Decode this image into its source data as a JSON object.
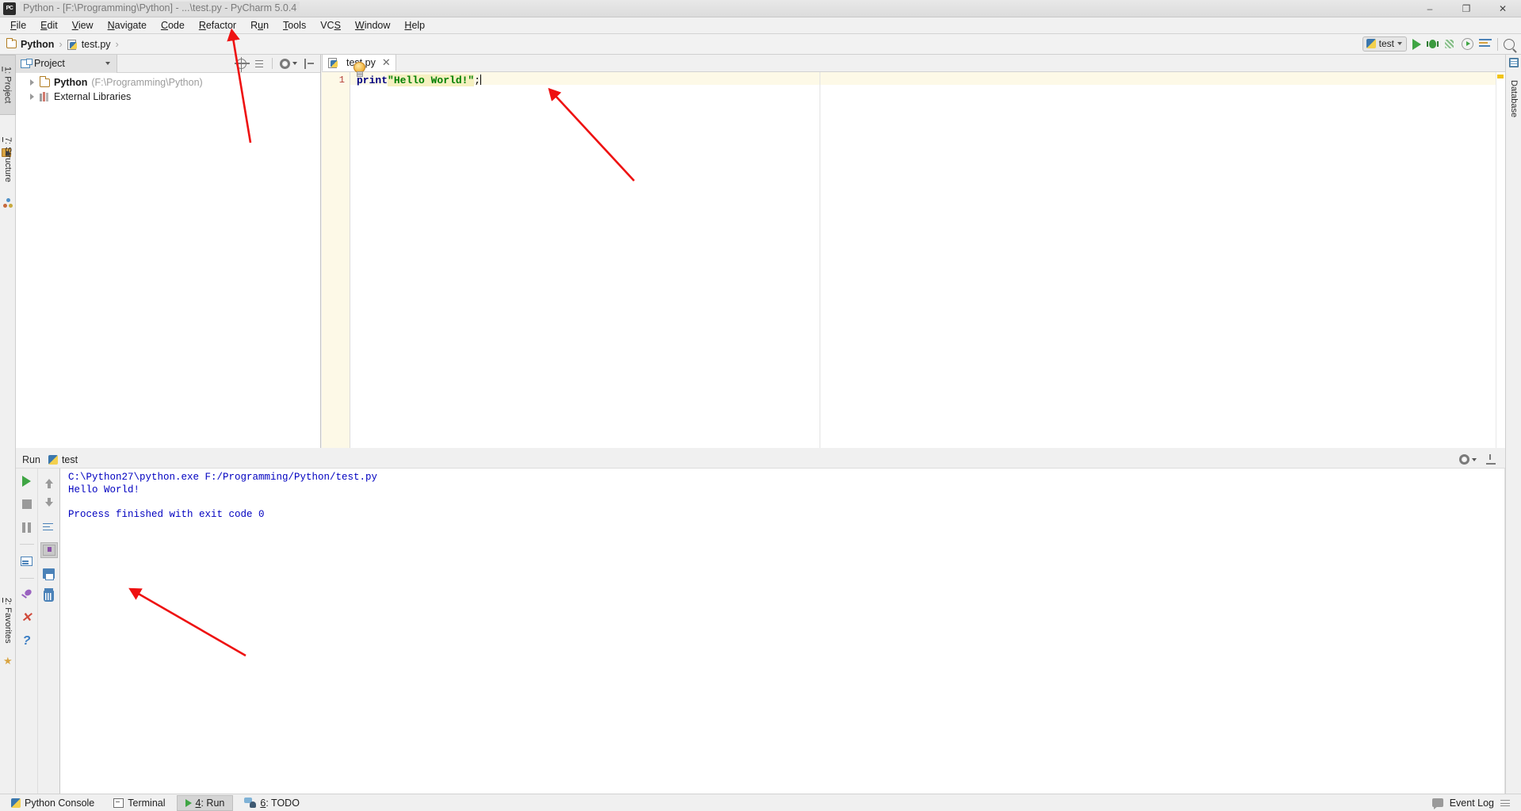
{
  "window": {
    "title": "Python - [F:\\Programming\\Python] - ...\\test.py - PyCharm 5.0.4",
    "app_icon": "PC",
    "minimize": "–",
    "maximize": "❐",
    "close": "✕"
  },
  "menu": [
    {
      "label": "File",
      "mnemonic": "F"
    },
    {
      "label": "Edit",
      "mnemonic": "E"
    },
    {
      "label": "View",
      "mnemonic": "V"
    },
    {
      "label": "Navigate",
      "mnemonic": "N"
    },
    {
      "label": "Code",
      "mnemonic": "C"
    },
    {
      "label": "Refactor",
      "mnemonic": "R"
    },
    {
      "label": "Run",
      "mnemonic": "u"
    },
    {
      "label": "Tools",
      "mnemonic": "T"
    },
    {
      "label": "VCS",
      "mnemonic": "S"
    },
    {
      "label": "Window",
      "mnemonic": "W"
    },
    {
      "label": "Help",
      "mnemonic": "H"
    }
  ],
  "breadcrumb": {
    "project": "Python",
    "file": "test.py",
    "separator": "›"
  },
  "nav_right": {
    "run_config": "test",
    "icons": [
      "run-icon",
      "debug-icon",
      "coverage-icon",
      "profile-icon",
      "attach-icon",
      "search-everywhere-icon"
    ]
  },
  "left_strip": [
    {
      "label": "1: Project",
      "mnemonic": "1",
      "icon": "project-icon",
      "active": true
    },
    {
      "label": "7: Structure",
      "mnemonic": "7",
      "icon": "structure-icon",
      "active": false
    },
    {
      "label": "2: Favorites",
      "mnemonic": "2",
      "icon": "star-icon",
      "active": false
    }
  ],
  "right_strip": [
    {
      "label": "Database",
      "icon": "database-icon",
      "active": false
    }
  ],
  "project_panel": {
    "tab_label": "Project",
    "toolbar_icons": [
      "target-icon",
      "collapse-all-icon",
      "gear-icon",
      "hide-icon"
    ],
    "tree": [
      {
        "label": "Python",
        "path": "(F:\\Programming\\Python)",
        "icon": "folder-icon",
        "expandable": true,
        "bold": true
      },
      {
        "label": "External Libraries",
        "path": "",
        "icon": "library-icon",
        "expandable": true,
        "bold": false
      }
    ]
  },
  "editor": {
    "tabs": [
      {
        "label": "test.py",
        "icon": "python-file-icon",
        "close": "✕",
        "active": true
      }
    ],
    "line_numbers": [
      "1"
    ],
    "code": {
      "keyword": "print",
      "string": "\"Hello World!\"",
      "punctuation": ";"
    },
    "intention_bulb": "lightbulb-icon"
  },
  "run_panel": {
    "title": "Run",
    "config_name": "test",
    "toolbar_left": [
      "rerun-icon",
      "stop-icon",
      "pause-icon",
      "console-icon",
      "pin-icon",
      "close-icon",
      "help-icon"
    ],
    "toolbar_right": [
      "up-icon",
      "down-icon",
      "soft-wrap-icon",
      "scroll-to-end-icon",
      "print-icon",
      "clear-all-icon"
    ],
    "header_icons": [
      "gear-icon",
      "hide-icon"
    ],
    "console_lines": [
      "C:\\Python27\\python.exe F:/Programming/Python/test.py",
      "Hello World!",
      "",
      "Process finished with exit code 0"
    ]
  },
  "statusbar": {
    "items": [
      {
        "label": "Python Console",
        "mnemonic": "",
        "icon": "python-console-icon",
        "active": false
      },
      {
        "label": "Terminal",
        "mnemonic": "",
        "icon": "terminal-icon",
        "active": false
      },
      {
        "label": "4: Run",
        "mnemonic": "4",
        "icon": "run-icon",
        "active": true
      },
      {
        "label": "6: TODO",
        "mnemonic": "6",
        "icon": "todo-icon",
        "active": false
      }
    ],
    "right": {
      "event_log": "Event Log",
      "icon": "event-log-icon"
    }
  },
  "colors": {
    "accent_green": "#3fa544",
    "annotation_red": "#ee1111",
    "keyword_blue": "#000080",
    "string_green": "#008000",
    "console_blue": "#0000c0",
    "line_highlight": "#fdf9e7"
  }
}
